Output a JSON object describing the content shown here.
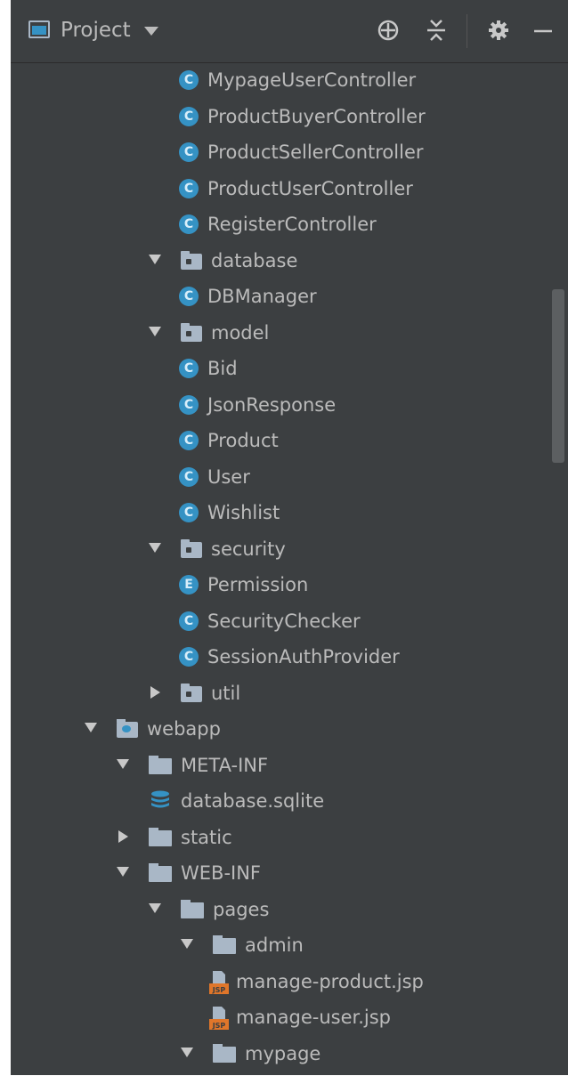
{
  "header": {
    "title": "Project",
    "icons": [
      "project-view-icon",
      "locate-icon",
      "collapse-all-icon",
      "settings-gear-icon",
      "minimize-icon"
    ]
  },
  "tree": [
    {
      "label": "MypageUserController",
      "kind": "class",
      "badge": "C",
      "indent": 5
    },
    {
      "label": "ProductBuyerController",
      "kind": "class",
      "badge": "C",
      "indent": 5
    },
    {
      "label": "ProductSellerController",
      "kind": "class",
      "badge": "C",
      "indent": 5
    },
    {
      "label": "ProductUserController",
      "kind": "class",
      "badge": "C",
      "indent": 5
    },
    {
      "label": "RegisterController",
      "kind": "class",
      "badge": "C",
      "indent": 5
    },
    {
      "label": "database",
      "kind": "package",
      "arrow": "open",
      "indent": 4
    },
    {
      "label": "DBManager",
      "kind": "class",
      "badge": "C",
      "indent": 5
    },
    {
      "label": "model",
      "kind": "package",
      "arrow": "open",
      "indent": 4
    },
    {
      "label": "Bid",
      "kind": "class",
      "badge": "C",
      "indent": 5
    },
    {
      "label": "JsonResponse",
      "kind": "class",
      "badge": "C",
      "indent": 5
    },
    {
      "label": "Product",
      "kind": "class",
      "badge": "C",
      "indent": 5
    },
    {
      "label": "User",
      "kind": "class",
      "badge": "C",
      "indent": 5
    },
    {
      "label": "Wishlist",
      "kind": "class",
      "badge": "C",
      "indent": 5
    },
    {
      "label": "security",
      "kind": "package",
      "arrow": "open",
      "indent": 4
    },
    {
      "label": "Permission",
      "kind": "enum",
      "badge": "E",
      "indent": 5
    },
    {
      "label": "SecurityChecker",
      "kind": "class",
      "badge": "C",
      "indent": 5
    },
    {
      "label": "SessionAuthProvider",
      "kind": "class",
      "badge": "C",
      "indent": 5
    },
    {
      "label": "util",
      "kind": "package",
      "arrow": "closed",
      "indent": 4
    },
    {
      "label": "webapp",
      "kind": "webroot",
      "arrow": "open",
      "indent": 2
    },
    {
      "label": "META-INF",
      "kind": "folder",
      "arrow": "open",
      "indent": 3
    },
    {
      "label": "database.sqlite",
      "kind": "database",
      "indent": 4
    },
    {
      "label": "static",
      "kind": "folder",
      "arrow": "closed",
      "indent": 3
    },
    {
      "label": "WEB-INF",
      "kind": "folder",
      "arrow": "open",
      "indent": 3
    },
    {
      "label": "pages",
      "kind": "folder",
      "arrow": "open",
      "indent": 4
    },
    {
      "label": "admin",
      "kind": "folder",
      "arrow": "open",
      "indent": 5
    },
    {
      "label": "manage-product.jsp",
      "kind": "jsp",
      "indent": 6
    },
    {
      "label": "manage-user.jsp",
      "kind": "jsp",
      "indent": 6
    },
    {
      "label": "mypage",
      "kind": "folder",
      "arrow": "open",
      "indent": 5
    }
  ],
  "colors": {
    "background": "#3c3f41",
    "text": "#bbbbbb",
    "class_icon": "#3592c4",
    "jsp_icon": "#e0762a"
  }
}
